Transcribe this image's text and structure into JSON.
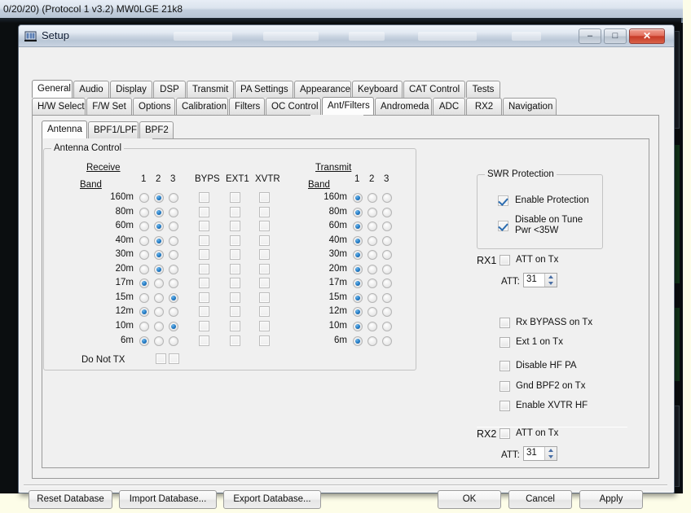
{
  "background_window": {
    "title": "0/20/20) (Protocol 1 v3.2) MW0LGE 21k8"
  },
  "window": {
    "title": "Setup",
    "icon": "app-icon",
    "controls": {
      "minimize": "–",
      "maximize": "□",
      "close": "✕"
    }
  },
  "tabs_level1": [
    {
      "label": "General",
      "selected": true
    },
    {
      "label": "Audio",
      "selected": false
    },
    {
      "label": "Display",
      "selected": false
    },
    {
      "label": "DSP",
      "selected": false
    },
    {
      "label": "Transmit",
      "selected": false
    },
    {
      "label": "PA Settings",
      "selected": false
    },
    {
      "label": "Appearance",
      "selected": false
    },
    {
      "label": "Keyboard",
      "selected": false
    },
    {
      "label": "CAT Control",
      "selected": false
    },
    {
      "label": "Tests",
      "selected": false
    }
  ],
  "tabs_level2": [
    {
      "label": "H/W Select",
      "selected": false
    },
    {
      "label": "F/W Set",
      "selected": false
    },
    {
      "label": "Options",
      "selected": false
    },
    {
      "label": "Calibration",
      "selected": false
    },
    {
      "label": "Filters",
      "selected": false
    },
    {
      "label": "OC Control",
      "selected": false
    },
    {
      "label": "Ant/Filters",
      "selected": true
    },
    {
      "label": "Andromeda",
      "selected": false
    },
    {
      "label": "ADC",
      "selected": false
    },
    {
      "label": "RX2",
      "selected": false
    },
    {
      "label": "Navigation",
      "selected": false
    }
  ],
  "tabs_level3": [
    {
      "label": "Antenna",
      "selected": true
    },
    {
      "label": "BPF1/LPF",
      "selected": false
    },
    {
      "label": "BPF2",
      "selected": false
    }
  ],
  "antenna_control": {
    "group_title": "Antenna Control",
    "receive": {
      "section_label": "Receive",
      "band_label": "Band",
      "ant_headers": [
        "1",
        "2",
        "3"
      ],
      "check_headers": [
        "BYPS",
        "EXT1",
        "XVTR"
      ]
    },
    "transmit": {
      "section_label": "Transmit",
      "band_label": "Band",
      "ant_headers": [
        "1",
        "2",
        "3"
      ]
    },
    "bands": [
      {
        "name": "160m",
        "rx_ant": 2,
        "tx_ant": 1,
        "byps": false,
        "ext1": false,
        "xvtr": false
      },
      {
        "name": "80m",
        "rx_ant": 2,
        "tx_ant": 1,
        "byps": false,
        "ext1": false,
        "xvtr": false
      },
      {
        "name": "60m",
        "rx_ant": 2,
        "tx_ant": 1,
        "byps": false,
        "ext1": false,
        "xvtr": false
      },
      {
        "name": "40m",
        "rx_ant": 2,
        "tx_ant": 1,
        "byps": false,
        "ext1": false,
        "xvtr": false
      },
      {
        "name": "30m",
        "rx_ant": 2,
        "tx_ant": 1,
        "byps": false,
        "ext1": false,
        "xvtr": false
      },
      {
        "name": "20m",
        "rx_ant": 2,
        "tx_ant": 1,
        "byps": false,
        "ext1": false,
        "xvtr": false
      },
      {
        "name": "17m",
        "rx_ant": 1,
        "tx_ant": 1,
        "byps": false,
        "ext1": false,
        "xvtr": false
      },
      {
        "name": "15m",
        "rx_ant": 3,
        "tx_ant": 1,
        "byps": false,
        "ext1": false,
        "xvtr": false
      },
      {
        "name": "12m",
        "rx_ant": 1,
        "tx_ant": 1,
        "byps": false,
        "ext1": false,
        "xvtr": false
      },
      {
        "name": "10m",
        "rx_ant": 3,
        "tx_ant": 1,
        "byps": false,
        "ext1": false,
        "xvtr": false
      },
      {
        "name": "6m",
        "rx_ant": 1,
        "tx_ant": 1,
        "byps": false,
        "ext1": false,
        "xvtr": false
      }
    ],
    "do_not_tx": {
      "label": "Do Not TX",
      "boxes": [
        false,
        false
      ]
    }
  },
  "swr_protection": {
    "group_title": "SWR Protection",
    "enable_protection": {
      "label": "Enable Protection",
      "checked": true
    },
    "disable_on_tune": {
      "label_line1": "Disable on Tune",
      "label_line2": "Pwr <35W",
      "checked": true
    }
  },
  "rx1": {
    "prefix": "RX1",
    "att_on_tx": {
      "label": "ATT on Tx",
      "checked": false
    },
    "att_label": "ATT:",
    "att_value": "31"
  },
  "rx2": {
    "prefix": "RX2",
    "att_on_tx": {
      "label": "ATT on Tx",
      "checked": false
    },
    "att_label": "ATT:",
    "att_value": "31"
  },
  "misc_options": [
    {
      "label": "Rx BYPASS on Tx",
      "checked": false,
      "name": "rx-bypass-on-tx"
    },
    {
      "label": "Ext 1 on Tx",
      "checked": false,
      "name": "ext1-on-tx"
    },
    {
      "label": "Disable HF PA",
      "checked": false,
      "name": "disable-hf-pa"
    },
    {
      "label": "Gnd BPF2 on Tx",
      "checked": false,
      "name": "gnd-bpf2-on-tx"
    },
    {
      "label": "Enable XVTR HF",
      "checked": false,
      "name": "enable-xvtr-hf"
    }
  ],
  "footer": {
    "reset_database": "Reset Database",
    "import_database": "Import Database...",
    "export_database": "Export Database...",
    "ok": "OK",
    "cancel": "Cancel",
    "apply": "Apply"
  },
  "colors": {
    "radio_on": "#2079c4",
    "check_mark": "#2b6cb0",
    "dialog_bg": "#f0f0f0",
    "close_red": "#c63a26"
  }
}
